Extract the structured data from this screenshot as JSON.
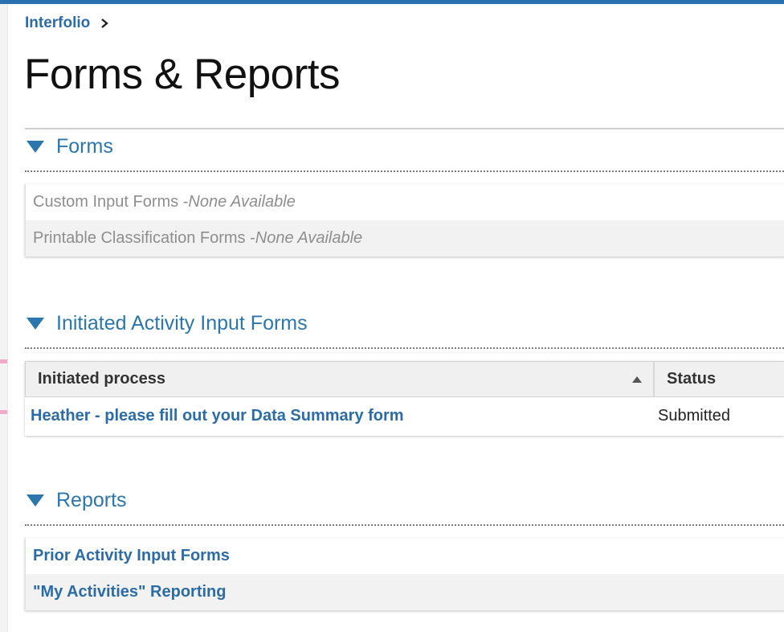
{
  "breadcrumb": {
    "root": "Interfolio"
  },
  "page": {
    "title": "Forms & Reports"
  },
  "forms_section": {
    "heading": "Forms",
    "rows": [
      {
        "label": "Custom Input Forms - ",
        "note": "None Available"
      },
      {
        "label": "Printable Classification Forms - ",
        "note": "None Available"
      }
    ]
  },
  "initiated_section": {
    "heading": "Initiated Activity Input Forms",
    "columns": {
      "process": "Initiated process",
      "status": "Status"
    },
    "rows": [
      {
        "process": "Heather - please fill out your Data Summary form",
        "status": "Submitted"
      }
    ]
  },
  "reports_section": {
    "heading": "Reports",
    "links": [
      "Prior Activity Input Forms",
      "\"My Activities\" Reporting"
    ]
  },
  "colors": {
    "accent": "#2b76ad",
    "link": "#2c6ca6",
    "top_bar": "#2a6fae"
  },
  "icons": {
    "collapse": "triangle-down-icon",
    "breadcrumb_sep": "chevron-right-icon",
    "sort": "sort-asc-icon"
  }
}
